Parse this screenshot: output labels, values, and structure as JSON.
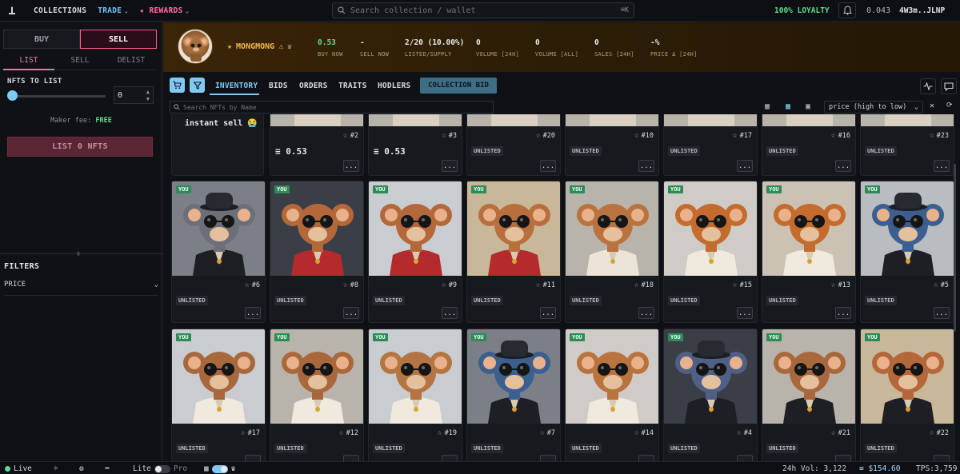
{
  "topbar": {
    "logo": "⊥",
    "nav": [
      {
        "label": "COLLECTIONS",
        "chevron": false,
        "style": "item"
      },
      {
        "label": "TRADE",
        "chevron": true,
        "style": "trade"
      },
      {
        "label": "★ REWARDS",
        "chevron": true,
        "style": "rewards"
      }
    ],
    "search_placeholder": "Search collection / wallet",
    "search_shortcut": "⌘K",
    "loyalty": "100% LOYALTY",
    "balance": "0.043",
    "wallet": "4W3m..JLNP"
  },
  "leftpanel": {
    "buy_label": "BUY",
    "sell_label": "SELL",
    "subtabs": [
      "LIST",
      "SELL",
      "DELIST"
    ],
    "active_subtab": "LIST",
    "nfts_to_list_label": "NFTS TO LIST",
    "quantity": "0",
    "maker_fee_label": "Maker fee:",
    "maker_fee_value": "FREE",
    "list_button": "LIST 0 NFTS",
    "filters_title": "FILTERS",
    "filter_price": "PRICE"
  },
  "collection": {
    "name": "MONGMONG",
    "stats": [
      {
        "value": "0.53",
        "label": "BUY NOW",
        "green": true
      },
      {
        "value": "-",
        "label": "SELL NOW",
        "green": false
      },
      {
        "value": "2/20 (10.00%)",
        "label": "LISTED/SUPPLY",
        "green": false
      },
      {
        "value": "0",
        "label": "VOLUME [24H]",
        "green": false
      },
      {
        "value": "0",
        "label": "VOLUME [ALL]",
        "green": false
      },
      {
        "value": "0",
        "label": "SALES [24H]",
        "green": false
      },
      {
        "value": "-%",
        "label": "PRICE Δ [24H]",
        "green": false
      }
    ]
  },
  "tabs": {
    "items": [
      "INVENTORY",
      "BIDS",
      "ORDERS",
      "TRAITS",
      "HODLERS"
    ],
    "active": "INVENTORY",
    "collection_bid": "COLLECTION BID"
  },
  "filterbar": {
    "search_placeholder": "Search NFTs by Name",
    "sort_value": "price (high to low)"
  },
  "grid": {
    "instant_sell_text": "instant sell 😭",
    "top_row": [
      {
        "id": "#2",
        "status": "≡ 0.53",
        "listed": true
      },
      {
        "id": "#3",
        "status": "≡ 0.53",
        "listed": true
      },
      {
        "id": "#20",
        "status": "UNLISTED",
        "listed": false
      },
      {
        "id": "#10",
        "status": "UNLISTED",
        "listed": false
      },
      {
        "id": "#17",
        "status": "UNLISTED",
        "listed": false
      },
      {
        "id": "#16",
        "status": "UNLISTED",
        "listed": false
      },
      {
        "id": "#23",
        "status": "UNLISTED",
        "listed": false
      }
    ],
    "row2": [
      {
        "id": "#6",
        "status": "UNLISTED",
        "badge": "YOU",
        "bg": "#7b8088",
        "fur": "#6d6f78",
        "jacket": "#1d1f24",
        "hat": true
      },
      {
        "id": "#8",
        "status": "UNLISTED",
        "badge": "YOU",
        "bg": "#3a3e46",
        "fur": "#b4683a",
        "jacket": "#b52a2a",
        "hat": false
      },
      {
        "id": "#9",
        "status": "UNLISTED",
        "badge": "YOU",
        "bg": "#c9ccd1",
        "fur": "#b4683a",
        "jacket": "#b52a2a",
        "hat": false
      },
      {
        "id": "#11",
        "status": "UNLISTED",
        "badge": "YOU",
        "bg": "#c9b79a",
        "fur": "#b86f3e",
        "jacket": "#b52a2a",
        "hat": false
      },
      {
        "id": "#18",
        "status": "UNLISTED",
        "badge": "YOU",
        "bg": "#b9b4ab",
        "fur": "#b9733f",
        "jacket": "#ebe4d7",
        "hat": false
      },
      {
        "id": "#15",
        "status": "UNLISTED",
        "badge": "YOU",
        "bg": "#cfccc7",
        "fur": "#c46b2e",
        "jacket": "#efe9de",
        "hat": false
      },
      {
        "id": "#13",
        "status": "UNLISTED",
        "badge": "YOU",
        "bg": "#ccc2b3",
        "fur": "#c46b2e",
        "jacket": "#efe9de",
        "hat": false
      },
      {
        "id": "#5",
        "status": "UNLISTED",
        "badge": "YOU",
        "bg": "#b9bcc0",
        "fur": "#3b5f8f",
        "jacket": "#1d1f24",
        "hat": true
      }
    ],
    "row3": [
      {
        "id": "#17",
        "status": "UNLISTED",
        "badge": "YOU",
        "bg": "#c9ccd1",
        "fur": "#a9683c",
        "jacket": "#efe9de",
        "hat": false
      },
      {
        "id": "#12",
        "status": "UNLISTED",
        "badge": "YOU",
        "bg": "#b9b4ab",
        "fur": "#a9683c",
        "jacket": "#efe9de",
        "hat": false
      },
      {
        "id": "#19",
        "status": "UNLISTED",
        "badge": "YOU",
        "bg": "#c9ccd1",
        "fur": "#b47542",
        "jacket": "#efe9de",
        "hat": false
      },
      {
        "id": "#7",
        "status": "UNLISTED",
        "badge": "YOU",
        "bg": "#7b8088",
        "fur": "#3b5f8f",
        "jacket": "#1d1f24",
        "hat": true
      },
      {
        "id": "#14",
        "status": "UNLISTED",
        "badge": "YOU",
        "bg": "#cfccc7",
        "fur": "#b9733f",
        "jacket": "#efe9de",
        "hat": false
      },
      {
        "id": "#4",
        "status": "UNLISTED",
        "badge": "YOU",
        "bg": "#3a3e46",
        "fur": "#4f5f86",
        "jacket": "#1d1f24",
        "hat": true
      },
      {
        "id": "#21",
        "status": "UNLISTED",
        "badge": "YOU",
        "bg": "#b9b4ab",
        "fur": "#a9683c",
        "jacket": "#1d1f24",
        "hat": false
      },
      {
        "id": "#22",
        "status": "UNLISTED",
        "badge": "YOU",
        "bg": "#c9b79a",
        "fur": "#b4683a",
        "jacket": "#1d1f24",
        "hat": false
      }
    ],
    "more_label": "..."
  },
  "bottombar": {
    "live": "Live",
    "lite": "Lite",
    "pro": "Pro",
    "volume": "24h Vol: 3,122",
    "sol_price": "≡ $154.60",
    "tps": "TPS:3,759"
  },
  "colors": {
    "accent": "#7fc9f5",
    "sell": "#ff5c8d",
    "green": "#5ddc8f",
    "gold": "#f2b84b"
  }
}
